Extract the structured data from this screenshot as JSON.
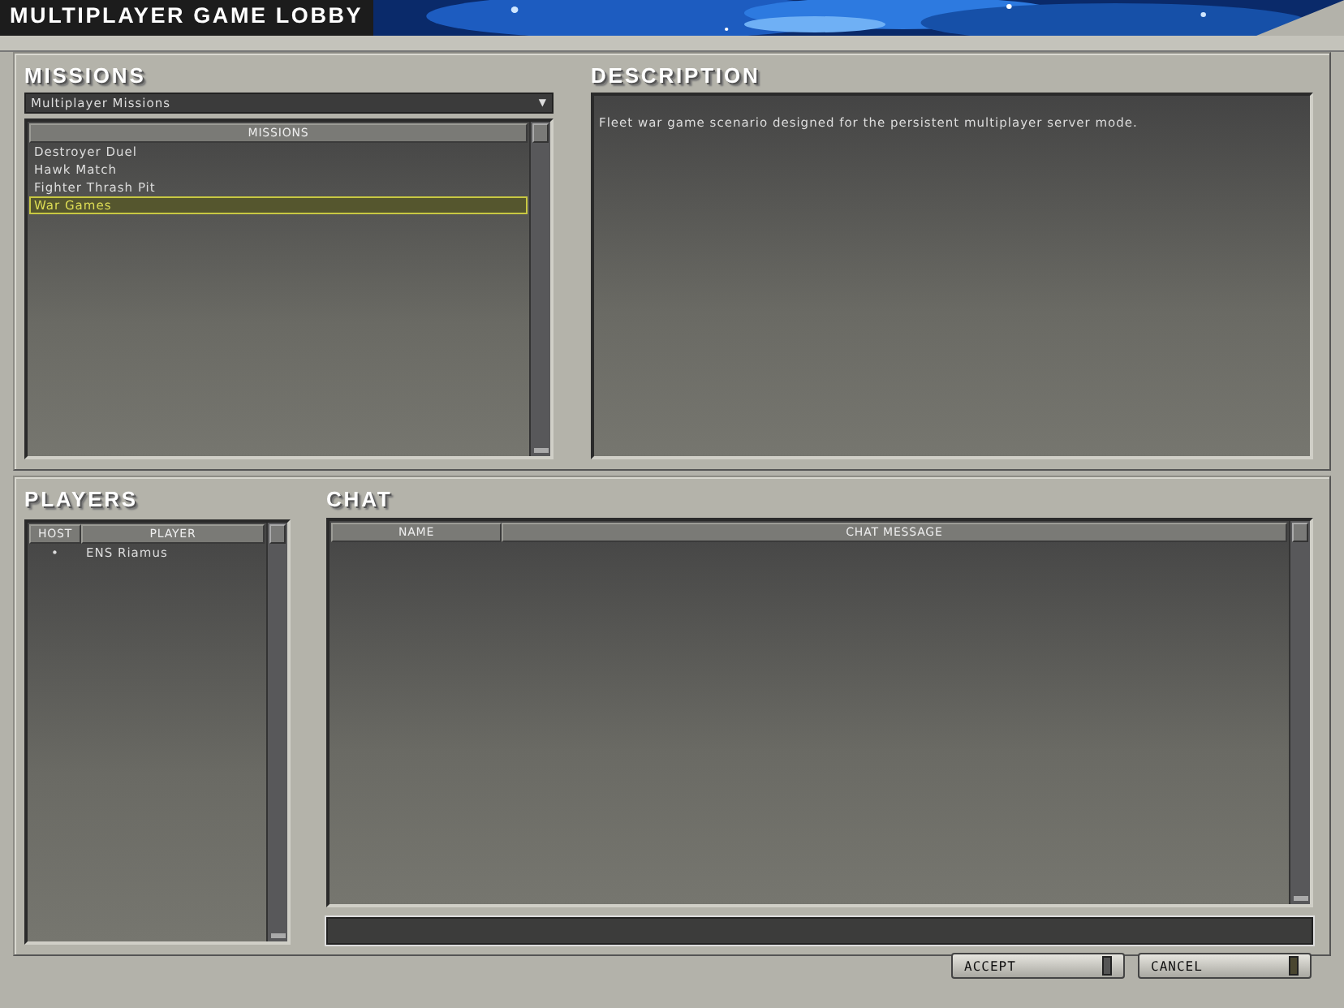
{
  "window": {
    "title": "MULTIPLAYER GAME LOBBY"
  },
  "missions": {
    "heading": "MISSIONS",
    "dropdown": {
      "value": "Multiplayer Missions",
      "caret": "▼"
    },
    "column": "MISSIONS",
    "items": [
      {
        "label": "Destroyer Duel",
        "selected": false
      },
      {
        "label": "Hawk Match",
        "selected": false
      },
      {
        "label": "Fighter Thrash Pit",
        "selected": false
      },
      {
        "label": "War Games",
        "selected": true
      }
    ]
  },
  "description": {
    "heading": "DESCRIPTION",
    "text": "Fleet war game scenario designed for the persistent multiplayer server mode."
  },
  "players": {
    "heading": "PLAYERS",
    "columns": [
      "HOST",
      "PLAYER"
    ],
    "rows": [
      {
        "host": "•",
        "player": "ENS Riamus"
      }
    ]
  },
  "chat": {
    "heading": "CHAT",
    "columns": [
      "NAME",
      "CHAT MESSAGE"
    ]
  },
  "buttons": [
    {
      "label": "ACCEPT"
    },
    {
      "label": "CANCEL"
    }
  ]
}
